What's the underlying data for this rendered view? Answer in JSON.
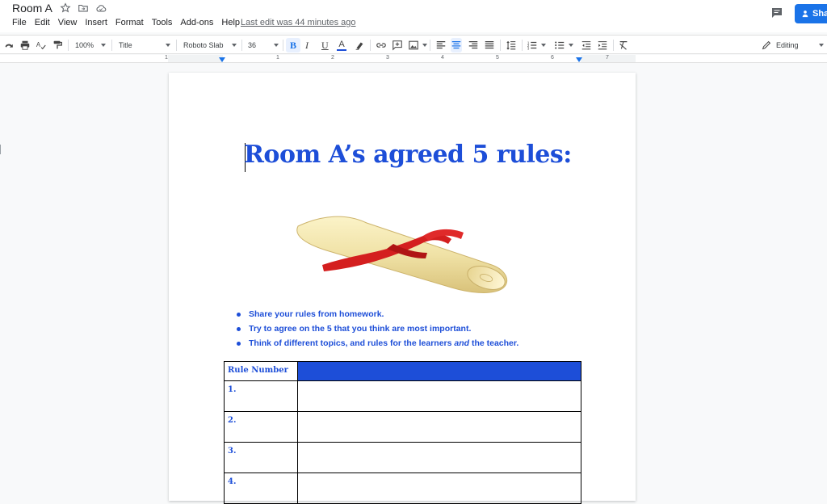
{
  "titlebar": {
    "doc_title": "Room A",
    "menu": [
      "File",
      "Edit",
      "View",
      "Insert",
      "Format",
      "Tools",
      "Add-ons",
      "Help"
    ],
    "last_edit": "Last edit was 44 minutes ago",
    "share_label": "Sha"
  },
  "toolbar": {
    "zoom": "100%",
    "style": "Title",
    "font": "Roboto Slab",
    "font_size": "36",
    "bold": "B",
    "italic": "I",
    "underline": "U",
    "text_color": "A",
    "mode": "Editing"
  },
  "ruler": {
    "numbers": [
      "1",
      "1",
      "2",
      "3",
      "4",
      "5",
      "6",
      "7"
    ]
  },
  "document": {
    "heading": "Room A’s agreed 5 rules:",
    "bullets": [
      "Share your rules from homework.",
      "Try to agree on the 5 that you think are most important.",
      "Think of different topics, and rules for the learners and the teacher."
    ],
    "table": {
      "header": [
        "Rule Number",
        ""
      ],
      "rows": [
        [
          "1.",
          ""
        ],
        [
          "2.",
          ""
        ],
        [
          "3.",
          ""
        ],
        [
          "4.",
          ""
        ]
      ]
    }
  },
  "colors": {
    "accent": "#1d4ed8",
    "share": "#1a73e8"
  }
}
